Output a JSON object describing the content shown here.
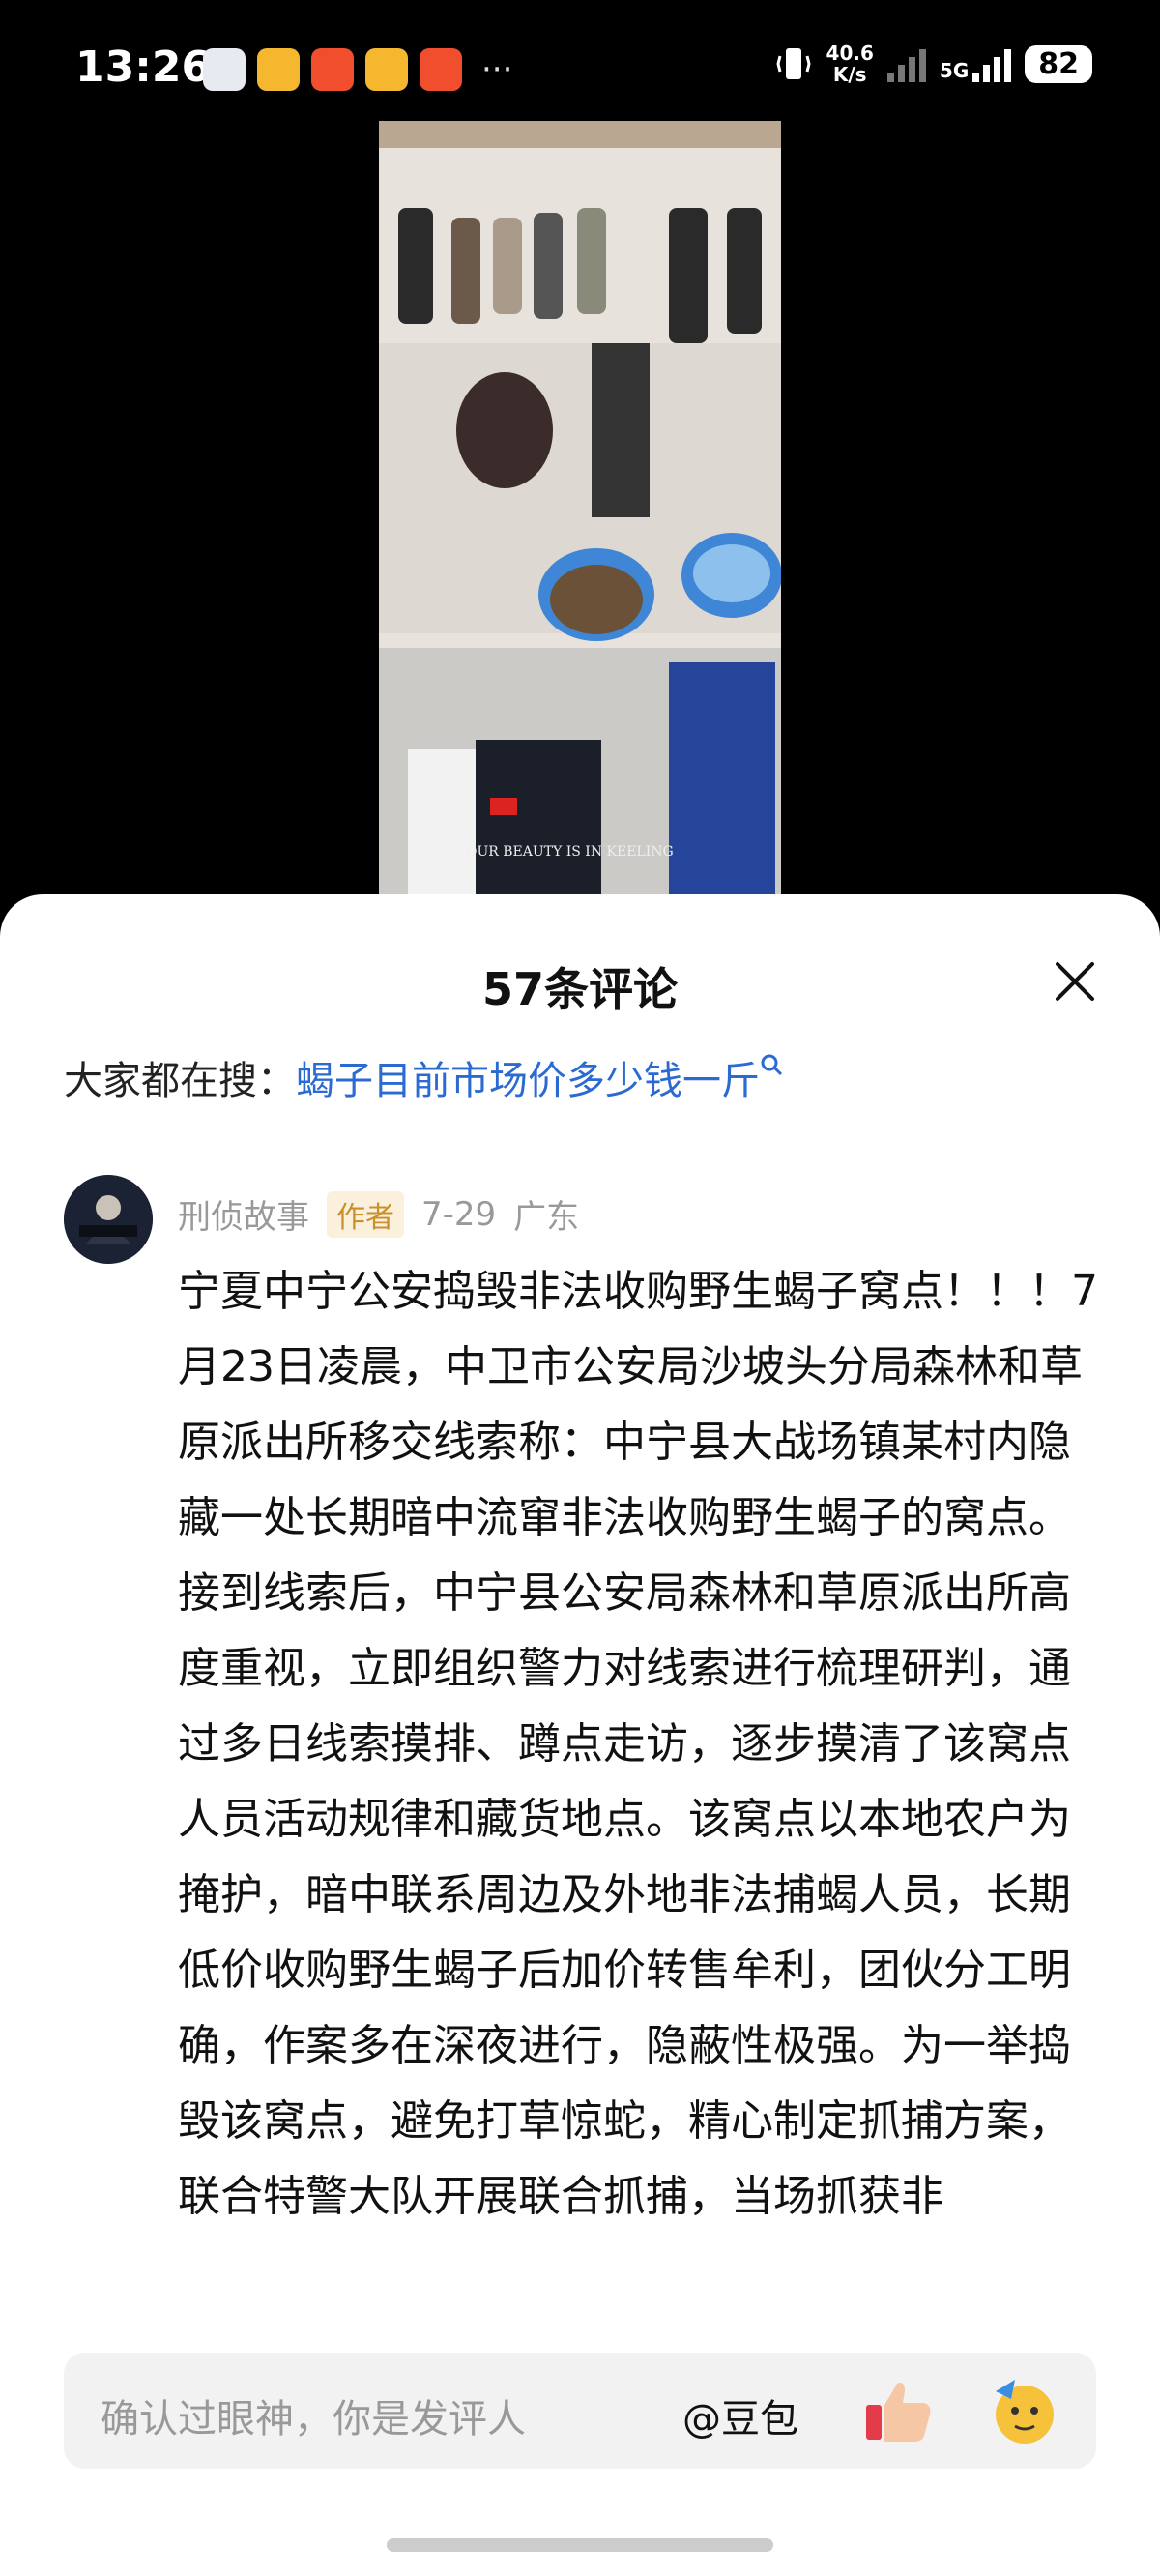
{
  "status": {
    "time": "13:26",
    "speed_value": "40.6",
    "speed_unit": "K/s",
    "network": "5G",
    "battery": "82"
  },
  "video": {
    "caption": "OUR BEAUTY IS IN KEELING"
  },
  "sheet": {
    "title": "57条评论",
    "search_label": "大家都在搜：",
    "search_query": "蝎子目前市场价多少钱一斤"
  },
  "comment": {
    "author": "刑侦故事",
    "author_badge": "作者",
    "date": "7-29",
    "location": "广东",
    "text": "宁夏中宁公安捣毁非法收购野生蝎子窝点！！！7月23日凌晨，中卫市公安局沙坡头分局森林和草原派出所移交线索称：中宁县大战场镇某村内隐藏一处长期暗中流窜非法收购野生蝎子的窝点。接到线索后，中宁县公安局森林和草原派出所高度重视，立即组织警力对线索进行梳理研判，通过多日线索摸排、蹲点走访，逐步摸清了该窝点人员活动规律和藏货地点。该窝点以本地农户为掩护，暗中联系周边及外地非法捕蝎人员，长期低价收购野生蝎子后加价转售牟利，团伙分工明确，作案多在深夜进行，隐蔽性极强。为一举捣毁该窝点，避免打草惊蛇，精心制定抓捕方案，联合特警大队开展联合抓捕，当场抓获非"
  },
  "input": {
    "placeholder": "确认过眼神，你是发评人",
    "mention": "@豆包"
  },
  "icons": {
    "close": "close-icon",
    "search": "search-icon",
    "thumb": "thumbs-up-emoji-icon",
    "face": "party-face-emoji-icon"
  }
}
